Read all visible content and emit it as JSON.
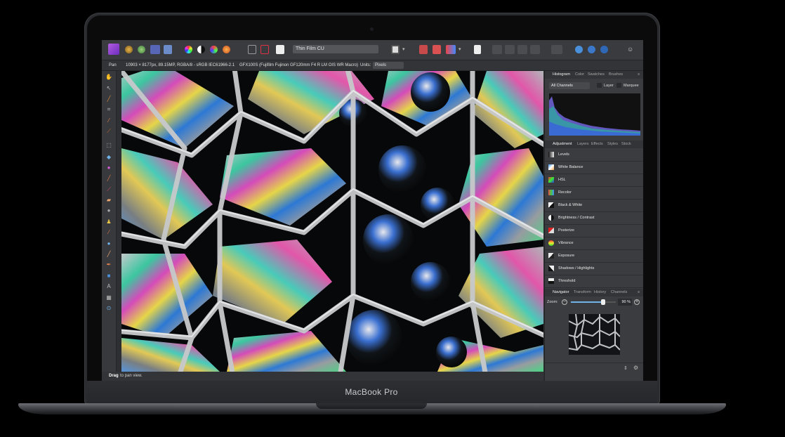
{
  "toolbar": {
    "preset_name": "Thin Film CU"
  },
  "context_bar": {
    "tool": "Pan",
    "document_info": "10903 × 8177px, 89.15MP, RGBA/8 - sRGB IEC61966-2.1",
    "camera": "GFX100S (Fujifilm Fujinon GF120mm F4 R LM OIS WR Macro)",
    "units_label": "Units:",
    "units_value": "Pixels"
  },
  "status": {
    "bold": "Drag",
    "rest": "to pan view."
  },
  "histogram_panel": {
    "tabs": [
      "Histogram",
      "Color",
      "Swatches",
      "Brushes"
    ],
    "channel_select": "All Channels",
    "layer_label": "Layer",
    "marquee_label": "Marquee"
  },
  "adjustment_panel": {
    "tabs": [
      "Adjustment",
      "Layers",
      "Effects",
      "Styles",
      "Stock"
    ],
    "items": [
      {
        "label": "Levels",
        "icon": "levels-icon"
      },
      {
        "label": "White Balance",
        "icon": "white-balance-icon"
      },
      {
        "label": "HSL",
        "icon": "hsl-icon"
      },
      {
        "label": "Recolor",
        "icon": "recolor-icon"
      },
      {
        "label": "Black & White",
        "icon": "black-white-icon"
      },
      {
        "label": "Brightness / Contrast",
        "icon": "brightness-contrast-icon"
      },
      {
        "label": "Posterize",
        "icon": "posterize-icon"
      },
      {
        "label": "Vibrance",
        "icon": "vibrance-icon"
      },
      {
        "label": "Exposure",
        "icon": "exposure-icon"
      },
      {
        "label": "Shadows / Highlights",
        "icon": "shadows-highlights-icon"
      },
      {
        "label": "Threshold",
        "icon": "threshold-icon"
      }
    ]
  },
  "navigator_panel": {
    "tabs": [
      "Navigator",
      "Transform",
      "History",
      "Channels"
    ],
    "zoom_label": "Zoom:",
    "zoom_value": "90 %",
    "zoom_level": 0.72
  },
  "device": {
    "brand": "MacBook Pro"
  },
  "colors": {
    "accent": "#8a3fd4",
    "panel": "#3b3c3f",
    "toolbar": "#3a3b3e"
  }
}
